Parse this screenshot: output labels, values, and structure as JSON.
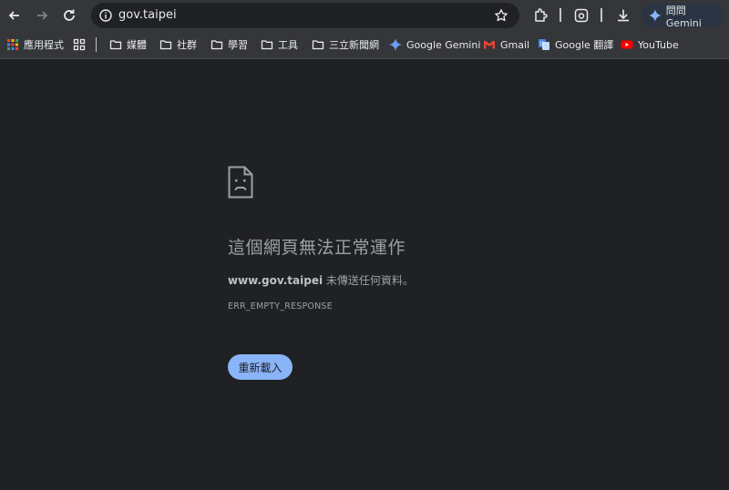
{
  "browser": {
    "url": "gov.taipei",
    "gemini_label": "問問 Gemini"
  },
  "bookmarks": {
    "apps_label": "應用程式",
    "items": [
      {
        "label": "媒體",
        "icon": "folder-icon"
      },
      {
        "label": "社群",
        "icon": "folder-icon"
      },
      {
        "label": "學習",
        "icon": "folder-icon"
      },
      {
        "label": "工具",
        "icon": "folder-icon"
      },
      {
        "label": "三立新聞網",
        "icon": "folder-icon"
      },
      {
        "label": "Google Gemini",
        "icon": "gemini-icon"
      },
      {
        "label": "Gmail",
        "icon": "gmail-icon"
      },
      {
        "label": "Google 翻譯",
        "icon": "translate-icon"
      },
      {
        "label": "YouTube",
        "icon": "youtube-icon"
      }
    ]
  },
  "error_page": {
    "title": "這個網頁無法正常運作",
    "host": "www.gov.taipei",
    "message": " 未傳送任何資料。",
    "code": "ERR_EMPTY_RESPONSE",
    "reload_label": "重新載入"
  },
  "colors": {
    "background": "#202124",
    "toolbar": "#35363a",
    "accent": "#8ab4f8"
  }
}
